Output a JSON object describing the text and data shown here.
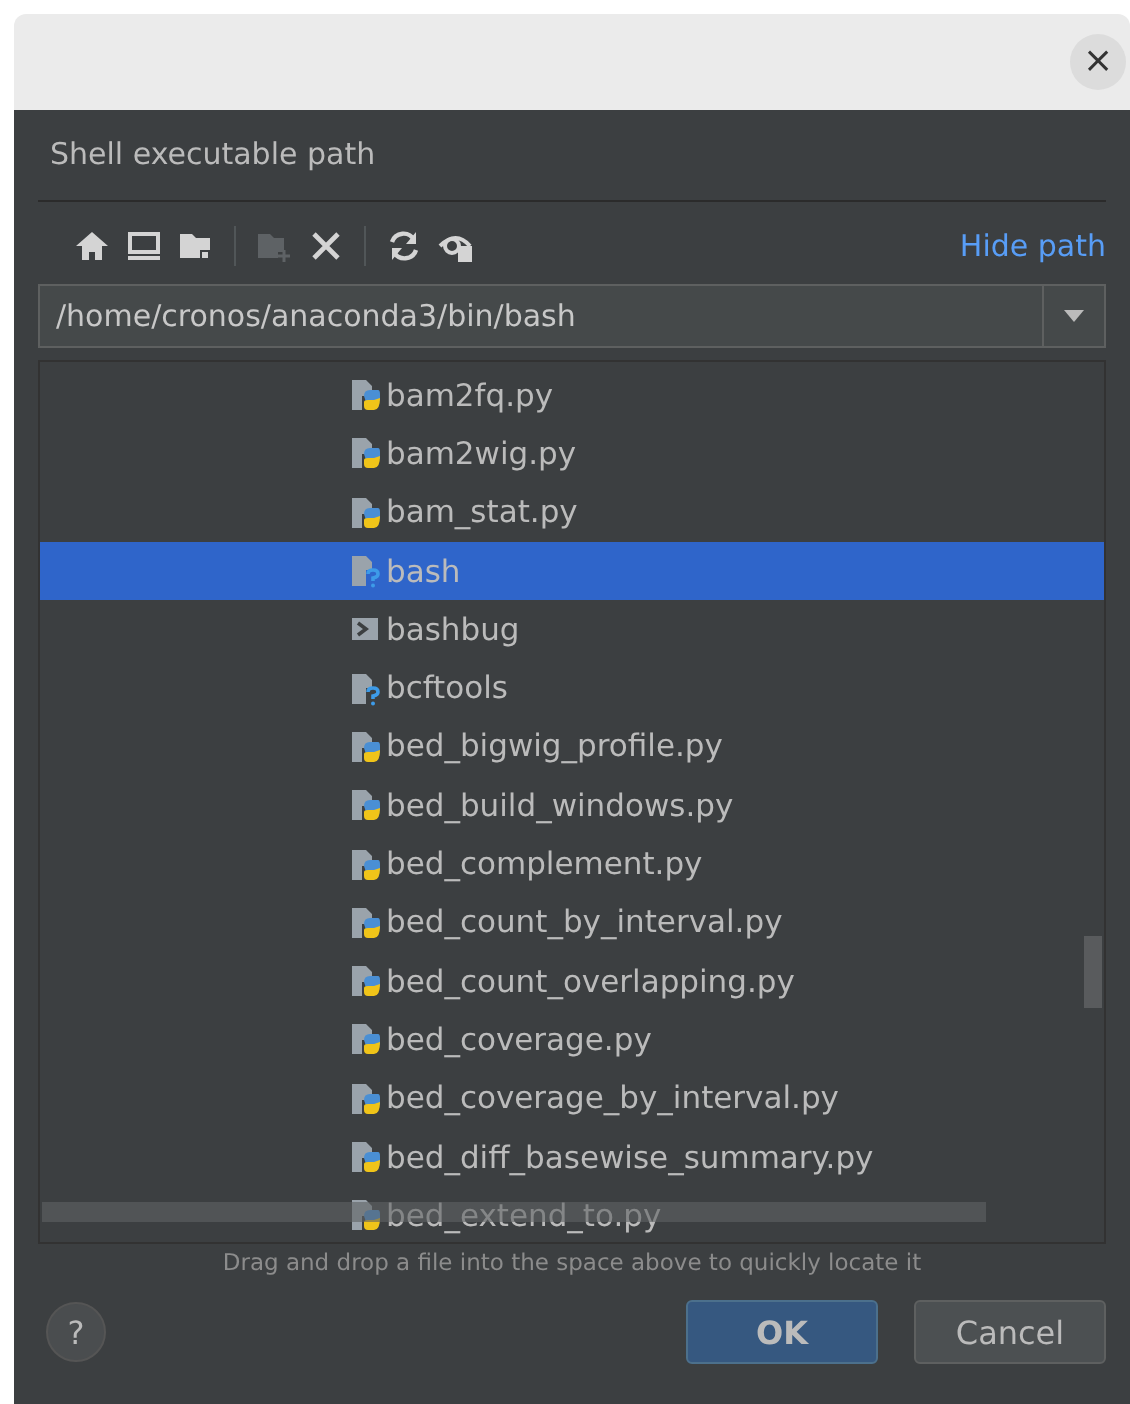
{
  "dialog": {
    "title": "Shell executable path",
    "hide_path_link": "Hide path",
    "path": "/home/cronos/anaconda3/bin/bash",
    "hint": "Drag and drop a file into the space above to quickly locate it",
    "buttons": [
      {
        "label": "OK",
        "kind": "primary"
      },
      {
        "label": "Cancel",
        "kind": "secondary"
      }
    ],
    "help": "?",
    "close": "×"
  },
  "toolbar": [
    {
      "kind": "home",
      "disabled": false
    },
    {
      "kind": "desktop",
      "disabled": false
    },
    {
      "kind": "folder",
      "disabled": false
    },
    {
      "kind": "separator"
    },
    {
      "kind": "new-folder",
      "disabled": true
    },
    {
      "kind": "delete",
      "disabled": false
    },
    {
      "kind": "separator"
    },
    {
      "kind": "refresh",
      "disabled": false
    },
    {
      "kind": "show-hidden",
      "disabled": false
    }
  ],
  "files": [
    {
      "name": "bam2fq.py",
      "kind": "python",
      "selected": false
    },
    {
      "name": "bam2wig.py",
      "kind": "python",
      "selected": false
    },
    {
      "name": "bam_stat.py",
      "kind": "python",
      "selected": false
    },
    {
      "name": "bash",
      "kind": "unknown",
      "selected": true
    },
    {
      "name": "bashbug",
      "kind": "script",
      "selected": false
    },
    {
      "name": "bcftools",
      "kind": "unknown",
      "selected": false
    },
    {
      "name": "bed_bigwig_profile.py",
      "kind": "python",
      "selected": false
    },
    {
      "name": "bed_build_windows.py",
      "kind": "python",
      "selected": false
    },
    {
      "name": "bed_complement.py",
      "kind": "python",
      "selected": false
    },
    {
      "name": "bed_count_by_interval.py",
      "kind": "python",
      "selected": false
    },
    {
      "name": "bed_count_overlapping.py",
      "kind": "python",
      "selected": false
    },
    {
      "name": "bed_coverage.py",
      "kind": "python",
      "selected": false
    },
    {
      "name": "bed_coverage_by_interval.py",
      "kind": "python",
      "selected": false
    },
    {
      "name": "bed_diff_basewise_summary.py",
      "kind": "python",
      "selected": false
    },
    {
      "name": "bed_extend_to.py",
      "kind": "python",
      "selected": false
    }
  ]
}
